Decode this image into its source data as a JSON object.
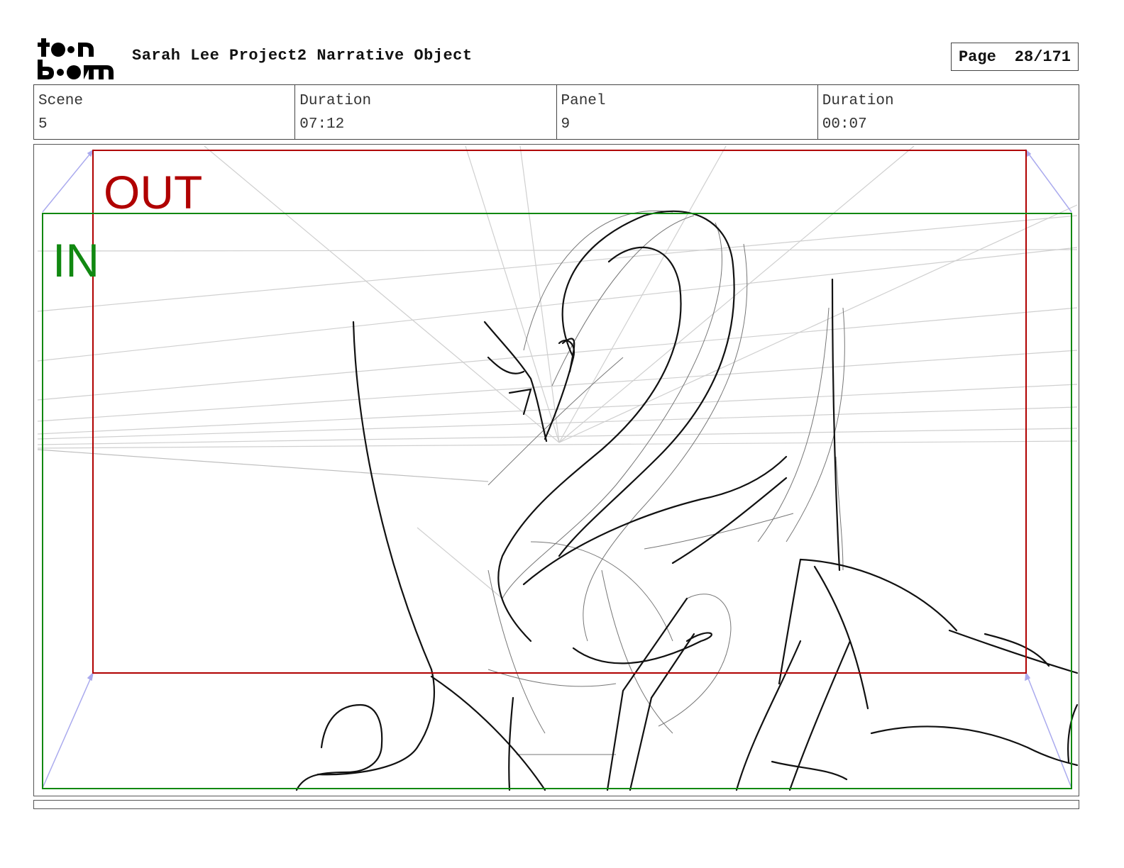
{
  "header": {
    "logo_text": "toon boom",
    "project_title": "Sarah Lee Project2 Narrative Object",
    "page_label": "Page",
    "page_value": "28/171"
  },
  "info": {
    "scene_label": "Scene",
    "scene_value": "5",
    "scene_duration_label": "Duration",
    "scene_duration_value": "07:12",
    "panel_label": "Panel",
    "panel_value": "9",
    "panel_duration_label": "Duration",
    "panel_duration_value": "00:07"
  },
  "camera": {
    "out_label": "OUT",
    "in_label": "IN",
    "out_color": "#b00000",
    "in_color": "#118811",
    "motion_color": "#aaaaee"
  },
  "sketch": {
    "subject": "pencil sketch of a long-necked dragon"
  }
}
